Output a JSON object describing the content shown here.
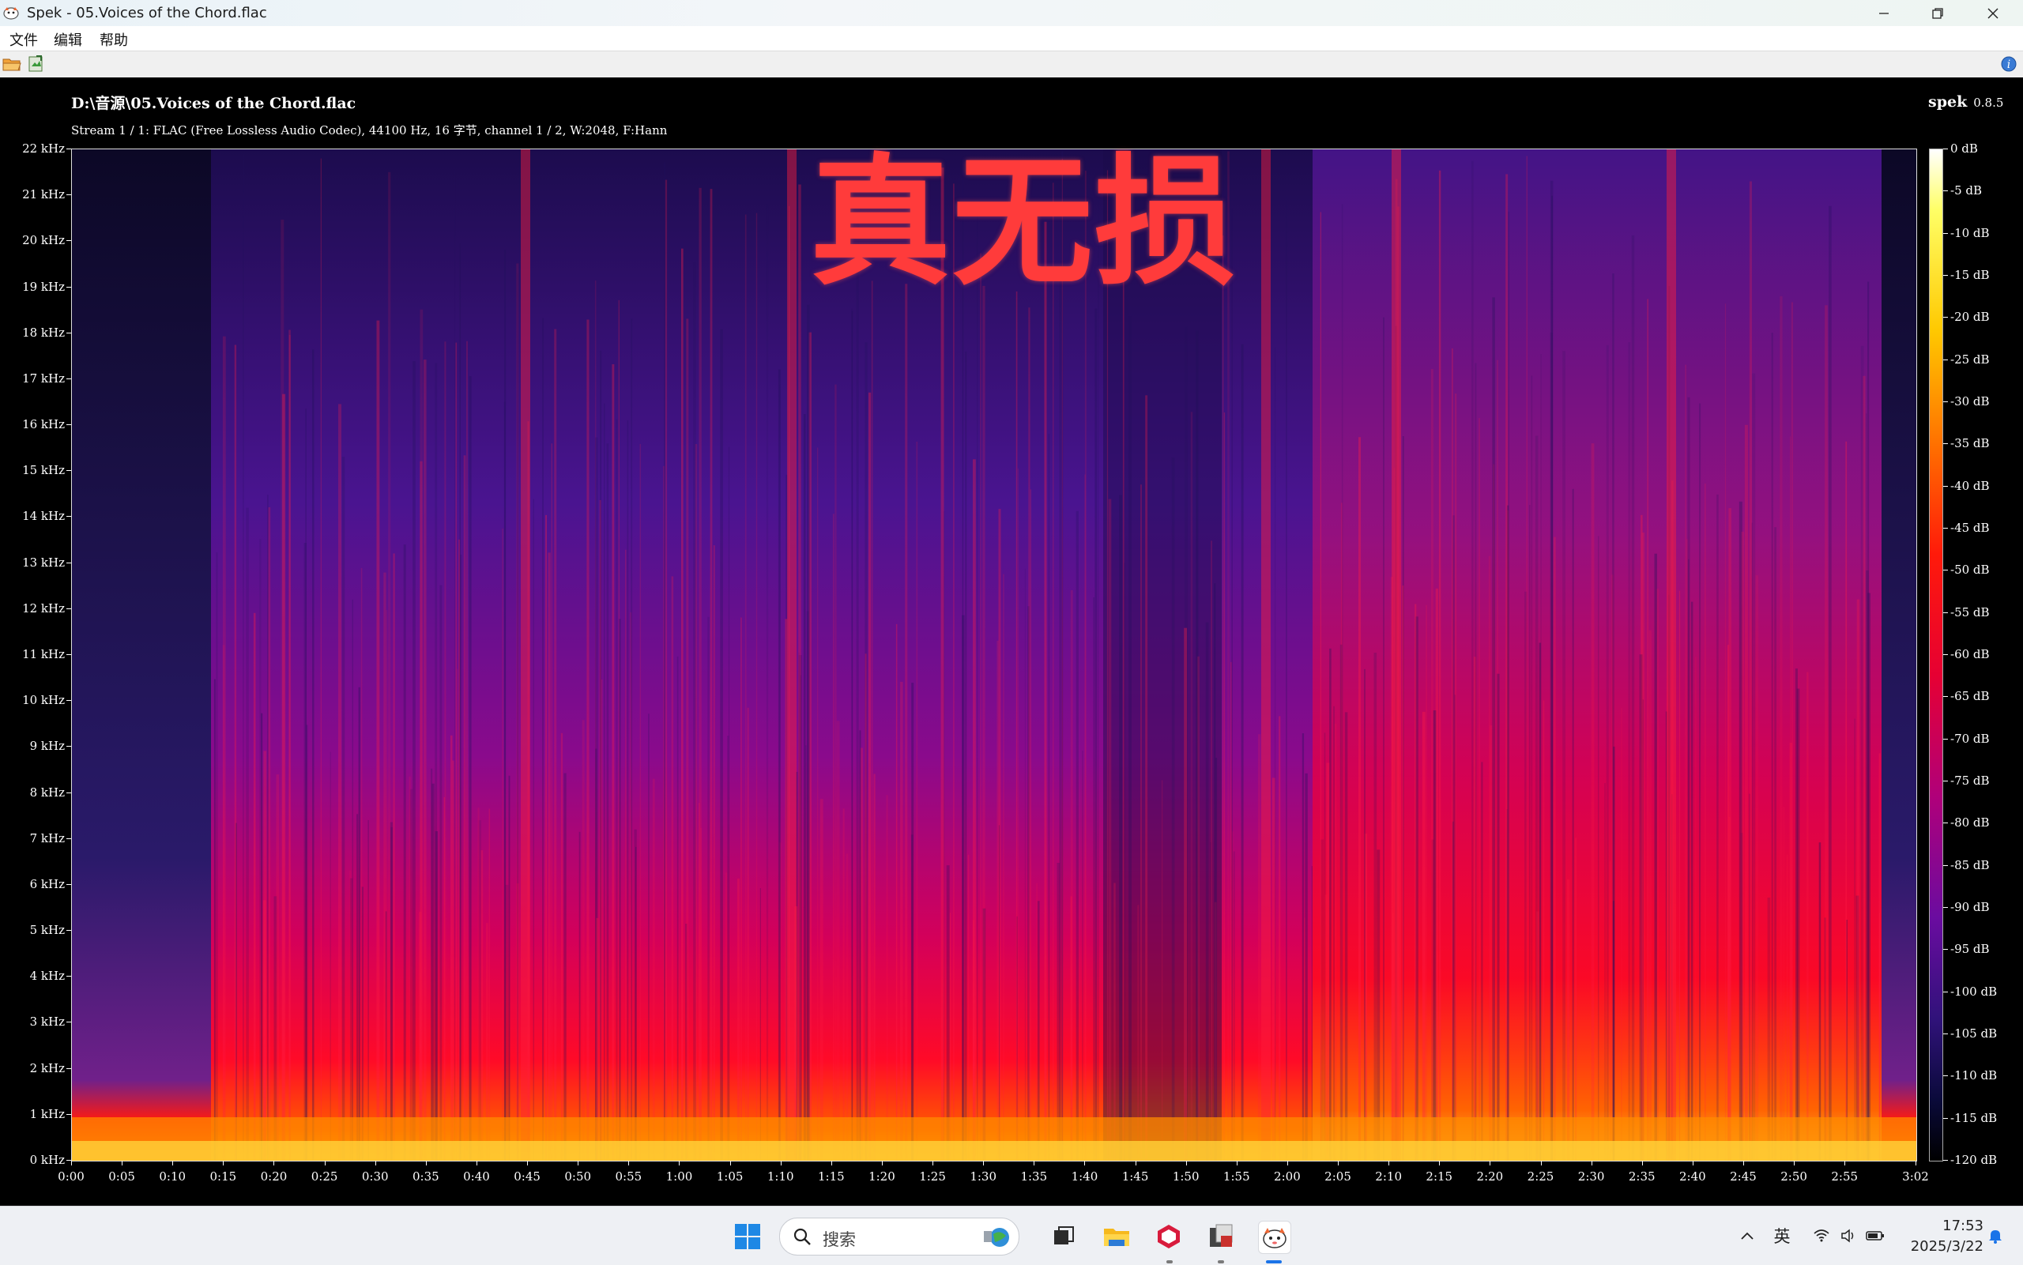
{
  "window": {
    "title": "Spek - 05.Voices of the Chord.flac",
    "controls": {
      "minimize": "minimize-icon",
      "restore": "restore-icon",
      "close": "close-icon"
    }
  },
  "menu": {
    "file": "文件",
    "edit": "编辑",
    "help": "帮助"
  },
  "toolbar": {
    "open": "folder-open-icon",
    "save": "save-image-icon",
    "about": "info-icon"
  },
  "spectrogram": {
    "file_path": "D:\\音源\\05.Voices of the Chord.flac",
    "stream_info": "Stream 1 / 1: FLAC (Free Lossless Audio Codec), 44100 Hz, 16 字节, channel 1 / 2, W:2048, F:Hann",
    "brand": "spek",
    "version": "0.8.5",
    "overlay_text": "真无损",
    "overlay_color": "#ff3b3b"
  },
  "chart_data": {
    "type": "heatmap",
    "title": "",
    "xlabel": "",
    "ylabel": "",
    "x_ticks": [
      "0:00",
      "0:05",
      "0:10",
      "0:15",
      "0:20",
      "0:25",
      "0:30",
      "0:35",
      "0:40",
      "0:45",
      "0:50",
      "0:55",
      "1:00",
      "1:05",
      "1:10",
      "1:15",
      "1:20",
      "1:25",
      "1:30",
      "1:35",
      "1:40",
      "1:45",
      "1:50",
      "1:55",
      "2:00",
      "2:05",
      "2:10",
      "2:15",
      "2:20",
      "2:25",
      "2:30",
      "2:35",
      "2:40",
      "2:45",
      "2:50",
      "2:55",
      "3:02"
    ],
    "y_ticks": [
      "0 kHz",
      "1 kHz",
      "2 kHz",
      "3 kHz",
      "4 kHz",
      "5 kHz",
      "6 kHz",
      "7 kHz",
      "8 kHz",
      "9 kHz",
      "10 kHz",
      "11 kHz",
      "12 kHz",
      "13 kHz",
      "14 kHz",
      "15 kHz",
      "16 kHz",
      "17 kHz",
      "18 kHz",
      "19 kHz",
      "20 kHz",
      "21 kHz",
      "22 kHz"
    ],
    "duration_seconds": 182,
    "ylim_khz": [
      0,
      22
    ],
    "colorbar_ticks": [
      "0 dB",
      "-5 dB",
      "-10 dB",
      "-15 dB",
      "-20 dB",
      "-25 dB",
      "-30 dB",
      "-35 dB",
      "-40 dB",
      "-45 dB",
      "-50 dB",
      "-55 dB",
      "-60 dB",
      "-65 dB",
      "-70 dB",
      "-75 dB",
      "-80 dB",
      "-85 dB",
      "-90 dB",
      "-95 dB",
      "-100 dB",
      "-105 dB",
      "-110 dB",
      "-115 dB",
      "-120 dB"
    ],
    "colorbar_range_db": [
      -120,
      0
    ]
  },
  "taskbar": {
    "search_placeholder": "搜索",
    "ime_label": "英",
    "time": "17:53",
    "date": "2025/3/22",
    "apps": [
      "start-icon",
      "task-view-icon",
      "file-explorer-icon",
      "app-hexagon-icon",
      "app-photo-icon",
      "spek-app-icon"
    ],
    "tray": [
      "show-hidden-icons-icon",
      "wifi-icon",
      "volume-icon",
      "battery-icon",
      "notification-bell-icon"
    ]
  }
}
